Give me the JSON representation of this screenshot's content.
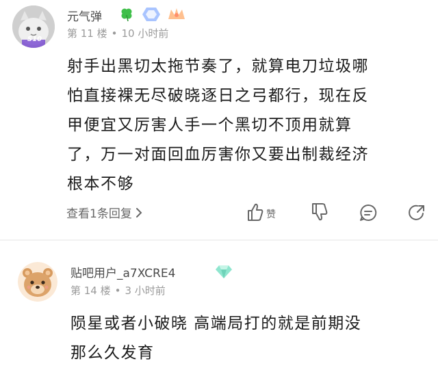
{
  "comments": [
    {
      "username": "元气弹",
      "floor": "第 11 楼",
      "time": "10 小时前",
      "avatar_badge": "S10",
      "text_lines": [
        "射手出黑切太拖节奏了，就算电刀垃圾哪",
        "怕直接裸无尽破晓逐日之弓都行，现在反",
        "甲便宜又厉害人手一个黑切不顶用就算",
        "了，万一对面回血厉害你又要出制裁经济",
        "根本不够"
      ],
      "view_replies": "查看1条回复",
      "like_label": "赞"
    },
    {
      "username": "贴吧用户_a7XCRE4",
      "floor": "第 14 楼",
      "time": "3 小时前",
      "text_lines": [
        "陨星或者小破晓 高端局打的就是前期没",
        "那么久发育"
      ]
    }
  ],
  "colors": {
    "clover": "#3fbf4a",
    "badge_blue": "#8fb2ff",
    "badge_orange": "#ffb27a",
    "diamond": "#7fe0c8"
  },
  "icons": [
    "clover-icon",
    "level-badge-icon",
    "fan-badge-icon",
    "chevron-right-icon",
    "thumb-up-icon",
    "thumb-down-icon",
    "comment-icon",
    "share-icon",
    "diamond-badge-icon"
  ]
}
